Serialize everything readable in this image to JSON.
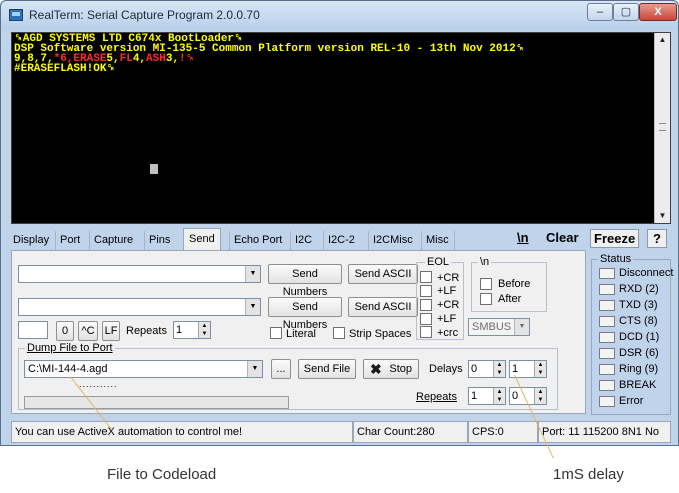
{
  "window": {
    "title": "RealTerm: Serial Capture Program 2.0.0.70",
    "controls": {
      "minimize": "–",
      "maximize": "▢",
      "close": "X"
    }
  },
  "terminal": {
    "line1": "␍AGD SYSTEMS LTD C674x BootLoader␍",
    "line2": "DSP Software version MI-135-5 Common Platform version REL-10 - 13th Nov 2012␍",
    "line3": {
      "a": "9,8,7,",
      "b": "*6,ERASE",
      "c": "5,",
      "d": "FL",
      "e": "4,",
      "f": "ASH",
      "g": "3,",
      "h": "!␍"
    },
    "line4": "#ERASEFLASH!OK␍"
  },
  "tabs": [
    "Display",
    "Port",
    "Capture",
    "Pins",
    "Send",
    "Echo Port",
    "I2C",
    "I2C-2",
    "I2CMisc",
    "Misc"
  ],
  "active_tab": "Send",
  "toolbar_right": {
    "newline": "\\n",
    "clear": "Clear",
    "freeze": "Freeze",
    "help": "?"
  },
  "send": {
    "row1": {
      "value": "",
      "send_numbers": "Send Numbers",
      "send_ascii": "Send ASCII"
    },
    "row2": {
      "value": "",
      "send_numbers": "Send Numbers",
      "send_ascii": "Send ASCII"
    },
    "small_value": "",
    "zero_btn": "0",
    "ctrl_btn": "^C",
    "lf_btn": "LF",
    "repeats_label": "Repeats",
    "repeats_value": "1",
    "literal_label": "Literal",
    "strip_spaces_label": "Strip Spaces"
  },
  "eol": {
    "title": "EOL",
    "options": [
      "+CR",
      "+LF",
      "+CR",
      "+LF",
      "+crc"
    ]
  },
  "n_group": {
    "title": "\\n",
    "before": "Before",
    "after": "After"
  },
  "smbus": "SMBUS 8",
  "dump": {
    "title": "Dump File to Port",
    "file": "C:\\MI-144-4.agd",
    "browse": "...",
    "send_file": "Send File",
    "stop": "Stop",
    "delays_label": "Delays",
    "delay1": "0",
    "delay2": "1",
    "repeats_label": "Repeats",
    "repeats1": "1",
    "repeats2": "0",
    "progress_dots": "..........."
  },
  "status": {
    "title": "Status",
    "items": [
      "Disconnect",
      "RXD (2)",
      "TXD (3)",
      "CTS (8)",
      "DCD (1)",
      "DSR (6)",
      "Ring (9)",
      "BREAK",
      "Error"
    ]
  },
  "statusbar": {
    "message": "You can use ActiveX automation to control me!",
    "char_count": "Char Count:280",
    "cps": "CPS:0",
    "port": "Port: 11 115200 8N1 No"
  },
  "callouts": {
    "file": "File to Codeload",
    "delay": "1mS delay"
  },
  "colors": {
    "terminal_bg": "#000000",
    "terminal_text": "#ffff00",
    "terminal_red": "#ff2a2a",
    "callout_line": "#e3b46a",
    "chrome": "#bfd3ea"
  }
}
